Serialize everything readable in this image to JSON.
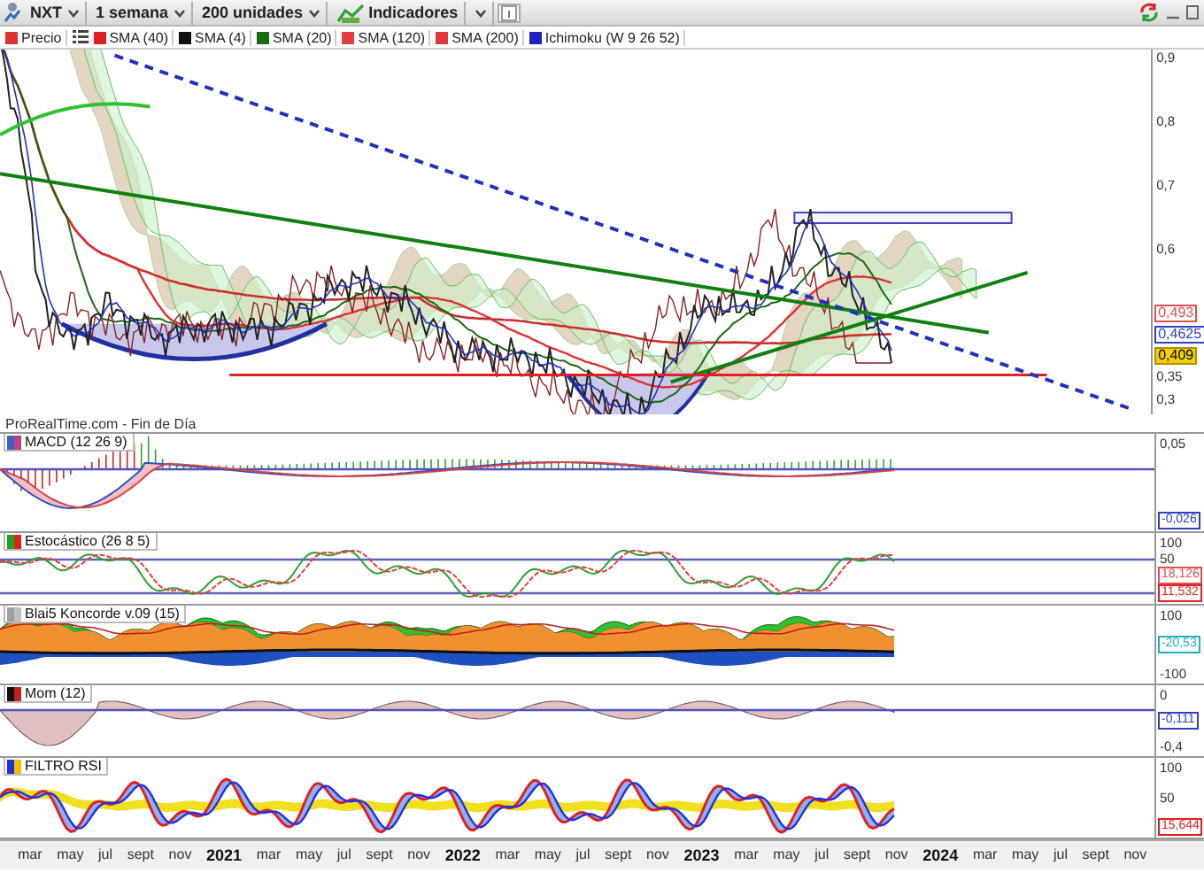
{
  "toolbar": {
    "symbol": "NXT",
    "period": "1 semana",
    "units": "200 unidades",
    "indicators": "Indicadores"
  },
  "legend": [
    {
      "label": "Precio",
      "color": "#e03030"
    },
    {
      "label": "SMA (40)",
      "color": "#e02020"
    },
    {
      "label": "SMA (4)",
      "color": "#111111"
    },
    {
      "label": "SMA (20)",
      "color": "#1a6a10"
    },
    {
      "label": "SMA (120)",
      "color": "#e04040"
    },
    {
      "label": "SMA (200)",
      "color": "#e03838"
    },
    {
      "label": "Ichimoku (W 9 26 52)",
      "color": "#2020c0"
    }
  ],
  "price_axis": [
    {
      "kind": "tick",
      "text": "0,9"
    },
    {
      "kind": "tick",
      "text": "0,8"
    },
    {
      "kind": "tick",
      "text": "0,7"
    },
    {
      "kind": "tick",
      "text": "0,6"
    },
    {
      "kind": "tag",
      "text": "0,493",
      "color": "#e05050"
    },
    {
      "kind": "tag",
      "text": "0,4625",
      "color": "#3040c0"
    },
    {
      "kind": "tag",
      "text": "0,409",
      "color": "#f0d000"
    },
    {
      "kind": "tick",
      "text": "0,35"
    },
    {
      "kind": "tick",
      "text": "0,3"
    }
  ],
  "source": "ProRealTime.com - Fin de Día",
  "panes": [
    {
      "kind": "macd",
      "title": "MACD (12 26 9)",
      "axis": [
        {
          "kind": "tick",
          "text": "0,05"
        },
        {
          "kind": "tag",
          "text": "-0,026",
          "color": "#3040c0"
        }
      ]
    },
    {
      "kind": "stochastic",
      "title": "Estocástico (26 8 5)",
      "axis": [
        {
          "kind": "tick",
          "text": "100"
        },
        {
          "kind": "tick",
          "text": "50"
        },
        {
          "kind": "tag",
          "text": "18,126",
          "color": "#e05050"
        },
        {
          "kind": "tag",
          "text": "11,532",
          "color": "#e02020"
        }
      ]
    },
    {
      "kind": "koncorde",
      "title": "Blai5 Koncorde v.09 (15)",
      "axis": [
        {
          "kind": "tick",
          "text": "100"
        },
        {
          "kind": "tag",
          "text": "-20,53",
          "color": "#20b0c0"
        },
        {
          "kind": "tick",
          "text": "-100"
        }
      ]
    },
    {
      "kind": "momentum",
      "title": "Mom (12)",
      "axis": [
        {
          "kind": "tick",
          "text": "0"
        },
        {
          "kind": "tag",
          "text": "-0,111",
          "color": "#3040c0"
        },
        {
          "kind": "tick",
          "text": "-0,4"
        }
      ]
    },
    {
      "kind": "rsi",
      "title": "FILTRO RSI",
      "axis": [
        {
          "kind": "tick",
          "text": "100"
        },
        {
          "kind": "tick",
          "text": "50"
        },
        {
          "kind": "tag",
          "text": "15,644",
          "color": "#e02020"
        }
      ]
    }
  ],
  "time_axis": [
    {
      "kind": "month",
      "text": "mar"
    },
    {
      "kind": "month",
      "text": "may"
    },
    {
      "kind": "month",
      "text": "jul"
    },
    {
      "kind": "month",
      "text": "sept"
    },
    {
      "kind": "month",
      "text": "nov"
    },
    {
      "kind": "year",
      "text": "2021"
    },
    {
      "kind": "month",
      "text": "mar"
    },
    {
      "kind": "month",
      "text": "may"
    },
    {
      "kind": "month",
      "text": "jul"
    },
    {
      "kind": "month",
      "text": "sept"
    },
    {
      "kind": "month",
      "text": "nov"
    },
    {
      "kind": "year",
      "text": "2022"
    },
    {
      "kind": "month",
      "text": "mar"
    },
    {
      "kind": "month",
      "text": "may"
    },
    {
      "kind": "month",
      "text": "jul"
    },
    {
      "kind": "month",
      "text": "sept"
    },
    {
      "kind": "month",
      "text": "nov"
    },
    {
      "kind": "year",
      "text": "2023"
    },
    {
      "kind": "month",
      "text": "mar"
    },
    {
      "kind": "month",
      "text": "may"
    },
    {
      "kind": "month",
      "text": "jul"
    },
    {
      "kind": "month",
      "text": "sept"
    },
    {
      "kind": "month",
      "text": "nov"
    },
    {
      "kind": "year",
      "text": "2024"
    },
    {
      "kind": "month",
      "text": "mar"
    },
    {
      "kind": "month",
      "text": "may"
    },
    {
      "kind": "month",
      "text": "jul"
    },
    {
      "kind": "month",
      "text": "sept"
    },
    {
      "kind": "month",
      "text": "nov"
    }
  ]
}
